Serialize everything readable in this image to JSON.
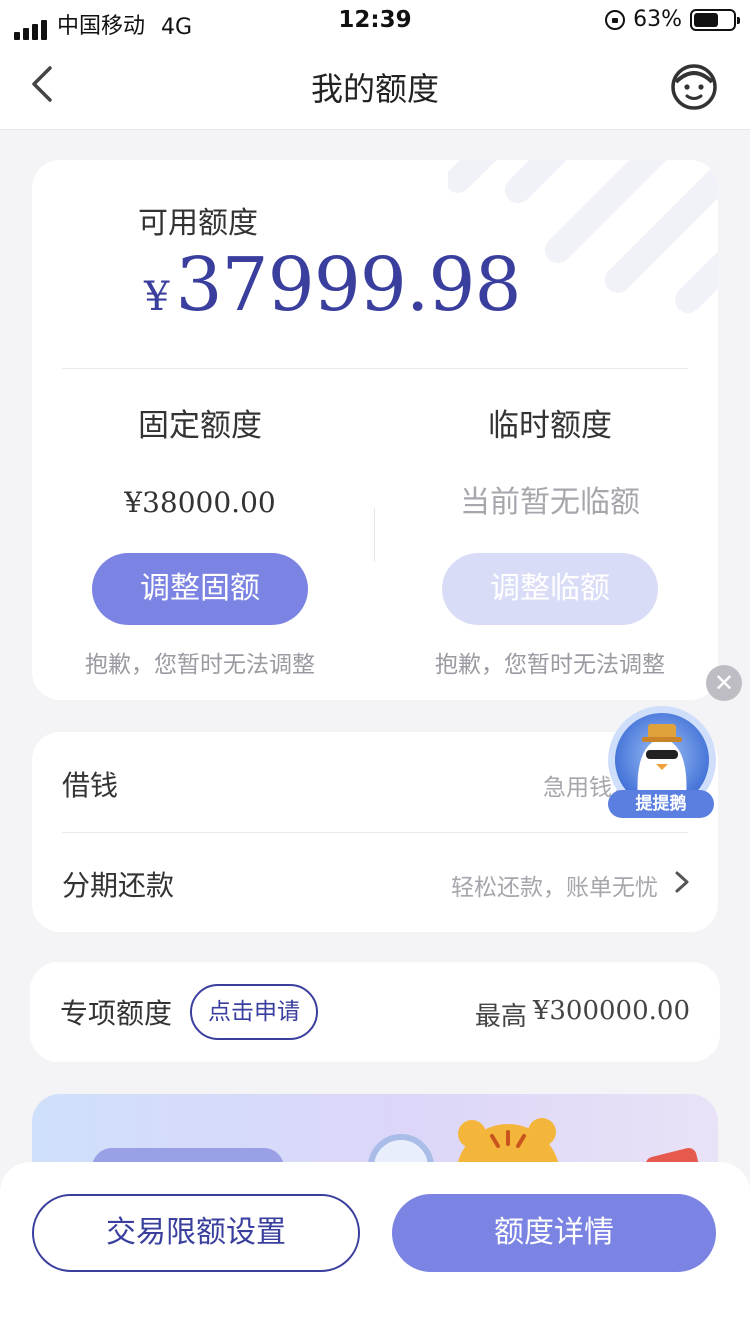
{
  "status_bar": {
    "carrier": "中国移动",
    "network": "4G",
    "time": "12:39",
    "battery": "63%",
    "battery_level": 0.63
  },
  "nav": {
    "title": "我的额度"
  },
  "quota": {
    "available_label": "可用额度",
    "currency_symbol": "¥",
    "available_amount": "37999.98",
    "fixed": {
      "title": "固定额度",
      "value": "¥38000.00",
      "button": "调整固额",
      "note": "抱歉，您暂时无法调整"
    },
    "temporary": {
      "title": "临时额度",
      "value": "当前暂无临额",
      "button": "调整临额",
      "note": "抱歉，您暂时无法调整"
    }
  },
  "floating": {
    "mascot_label": "提提鹅",
    "close_symbol": "✕"
  },
  "menu": [
    {
      "title": "借钱",
      "desc": "急用钱，秒"
    },
    {
      "title": "分期还款",
      "desc": "轻松还款，账单无忧"
    }
  ],
  "special": {
    "title": "专项额度",
    "apply_button": "点击申请",
    "max_label": "最高",
    "max_value": "¥300000.00"
  },
  "bottom": {
    "limit_button": "交易限额设置",
    "detail_button": "额度详情"
  },
  "colors": {
    "accent": "#3a3f9e",
    "button_primary": "#7b84e3",
    "button_disabled": "#d9dcf6",
    "background": "#f4f4f7"
  }
}
